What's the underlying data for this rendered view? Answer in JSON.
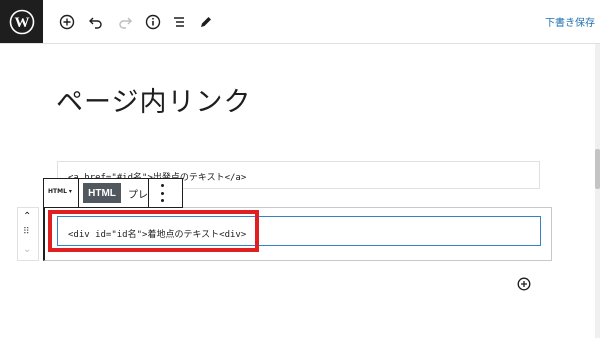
{
  "toolbar": {
    "save_draft_label": "下書き保存",
    "icons": [
      "wordpress-logo-icon",
      "add-block-icon",
      "undo-icon",
      "redo-icon",
      "info-icon",
      "list-view-icon",
      "edit-icon"
    ]
  },
  "post": {
    "title": "ページ内リンク"
  },
  "blocks": [
    {
      "type": "html",
      "content": "<a href=\"#id名\">出発点のテキスト</a>"
    },
    {
      "type": "html",
      "content": "<div id=\"id名\">着地点のテキスト<div>"
    }
  ],
  "block_toolbar": {
    "type_label": "HTML",
    "type_caret": "▾",
    "html_tab": "HTML",
    "preview_tab": "プレ"
  },
  "block_mover": {
    "up": "⌃",
    "drag": "⠿",
    "down": "⌄"
  },
  "colors": {
    "accent": "#2271b1",
    "highlight": "#e02020",
    "dark": "#1e1e1e"
  }
}
